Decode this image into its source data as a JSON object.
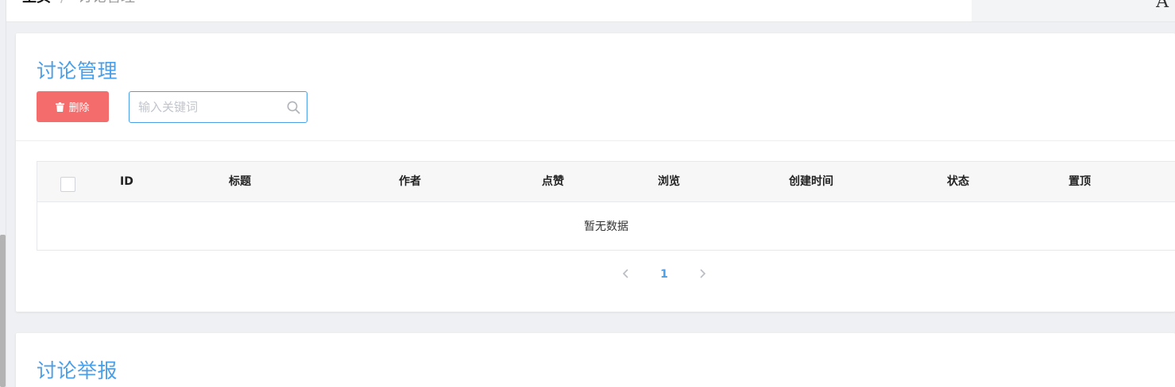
{
  "breadcrumb": {
    "home": "主页",
    "separator": "/",
    "current": "讨论管理"
  },
  "topbar": {
    "right_icon": "A"
  },
  "discussion": {
    "title": "讨论管理",
    "delete_label": "删除",
    "search_placeholder": "输入关键词",
    "columns": [
      "ID",
      "标题",
      "作者",
      "点赞",
      "浏览",
      "创建时间",
      "状态",
      "置顶"
    ],
    "empty_text": "暂无数据",
    "pagination": {
      "current_page": "1"
    }
  },
  "report": {
    "title": "讨论举报"
  },
  "colors": {
    "accent": "#4a9fe8",
    "danger": "#f56c6c",
    "header_bg": "#f7f7f7"
  },
  "icons": [
    "trash-icon",
    "search-icon",
    "chevron-left-icon",
    "chevron-right-icon"
  ]
}
